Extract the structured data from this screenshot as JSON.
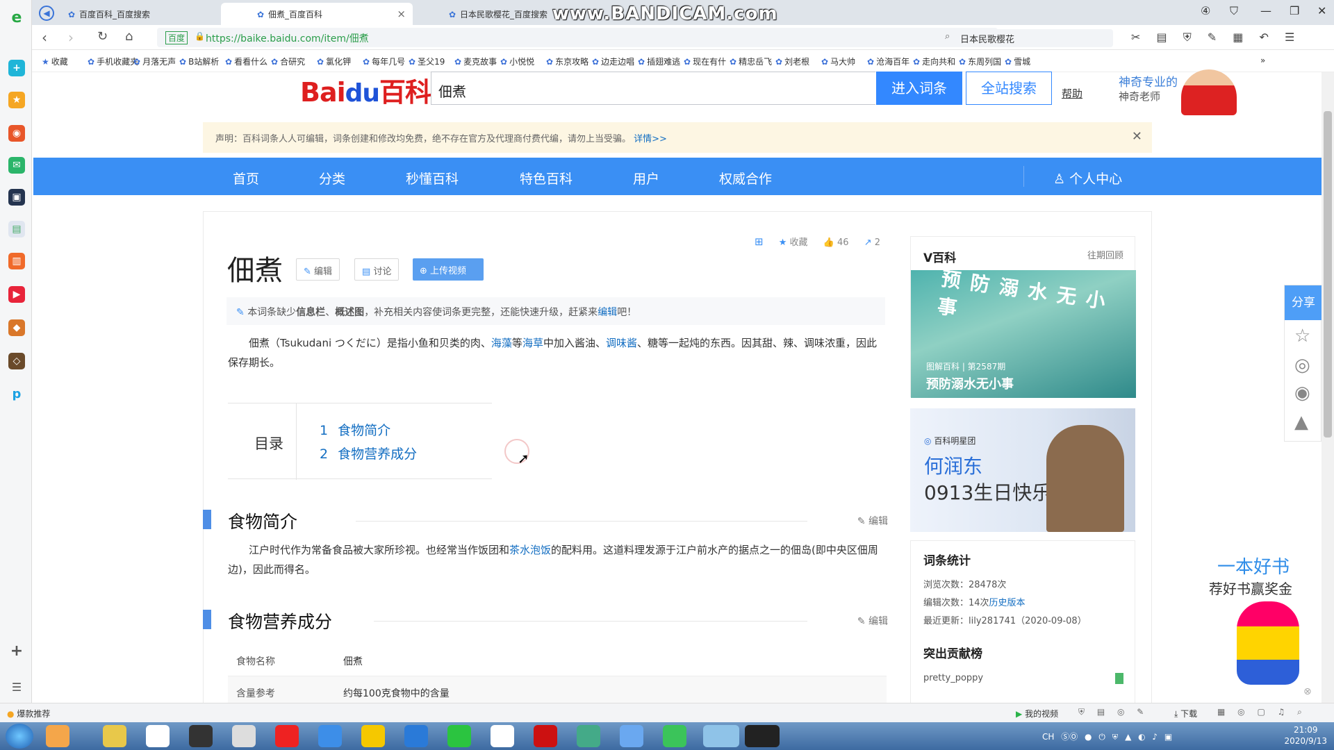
{
  "browser": {
    "tabs": [
      {
        "title": "百度百科_百度搜索",
        "active": false
      },
      {
        "title": "佃煮_百度百科",
        "active": true
      },
      {
        "title": "日本民歌樱花_百度搜索",
        "active": false
      }
    ],
    "watermark": "www.BANDICAM.com",
    "url_site_label": "百度",
    "url": "https://baike.baidu.com/item/佃煮",
    "search_value": "日本民歌樱花",
    "bookmarks": [
      "收藏",
      "手机收藏夹",
      "月落无声",
      "B站解析",
      "看看什么",
      "合研究",
      "氯化钾",
      "每年几号",
      "圣父19",
      "麦克故事",
      "小悦悦",
      "东京攻略",
      "边走边唱",
      "插翅难逃",
      "现在有什",
      "精忠岳飞",
      "刘老根",
      "马大帅",
      "沧海百年",
      "走向共和",
      "东周列国",
      "雪城"
    ]
  },
  "baike": {
    "logo_text": "Bai",
    "logo_paw": "du",
    "logo_suffix": "百科",
    "search_value": "佃煮",
    "enter_label": "进入词条",
    "site_search_label": "全站搜索",
    "help_label": "帮助",
    "promo_line1": "神奇专业的",
    "promo_line2": "神奇老师",
    "notice_text": "声明：百科词条人人可编辑，词条创建和修改均免费，绝不存在官方及代理商付费代编，请勿上当受骗。",
    "notice_link": "详情>>",
    "nav": [
      "首页",
      "分类",
      "秒懂百科",
      "特色百科",
      "用户",
      "权威合作"
    ],
    "nav_user": "个人中心"
  },
  "entry": {
    "title": "佃煮",
    "edit_label": "编辑",
    "discuss_label": "讨论",
    "upload_label": "上传视频",
    "collect_label": "收藏",
    "likes": "46",
    "shares": "2",
    "missing_prefix": "本词条缺少",
    "missing_bold1": "信息栏",
    "missing_sep": "、",
    "missing_bold2": "概述图",
    "missing_mid": "，补充相关内容使词条更完整，还能快速升级，赶紧来",
    "missing_link": "编辑",
    "missing_suffix": "吧！",
    "intro_a": "佃煮（Tsukudani つくだに）是指小鱼和贝类的肉、",
    "intro_link1": "海藻",
    "intro_b": "等",
    "intro_link2": "海草",
    "intro_c": "中加入酱油、",
    "intro_link3": "调味酱",
    "intro_d": "、糖等一起炖的东西。因其甜、辣、调味浓重，因此保存期长。",
    "toc_title": "目录",
    "toc": [
      {
        "num": "1",
        "label": "食物简介"
      },
      {
        "num": "2",
        "label": "食物营养成分"
      }
    ],
    "sec1_title": "食物简介",
    "sec1_a": "江户时代作为常备食品被大家所珍视。也经常当作饭团和",
    "sec1_link": "茶水泡饭",
    "sec1_b": "的配料用。这道料理发源于江户前水产的据点之一的佃岛(即中央区佃周边)，因此而得名。",
    "sec2_title": "食物营养成分",
    "section_edit": "编辑",
    "nutrition": [
      {
        "key": "食物名称",
        "value": "佃煮"
      },
      {
        "key": "含量参考",
        "value": "约每100克食物中的含量"
      }
    ]
  },
  "sidebar": {
    "vbaike_title": "V百科",
    "vbaike_more": "往期回顾",
    "vbaike_deco": "预防溺水无小事",
    "vbaike_sub": "图解百科 | 第2587期",
    "vbaike_caption": "预防溺水无小事",
    "star_tag": "百科明星团",
    "star_name": "何润东",
    "star_bday": "0913生日快乐",
    "stats_title": "词条统计",
    "views": "浏览次数：28478次",
    "edits_prefix": "编辑次数：14次",
    "edits_link": "历史版本",
    "updated": "最近更新：lily281741（2020-09-08）",
    "contrib_title": "突出贡献榜",
    "contributor": "pretty_poppy",
    "share_label": "分享",
    "ad_line1": "一本好书",
    "ad_line2": "荐好书赢奖金"
  },
  "status": {
    "left": "爆款推荐",
    "video": "我的视频",
    "download": "下载"
  },
  "taskbar": {
    "time": "21:09",
    "date": "2020/9/13"
  }
}
